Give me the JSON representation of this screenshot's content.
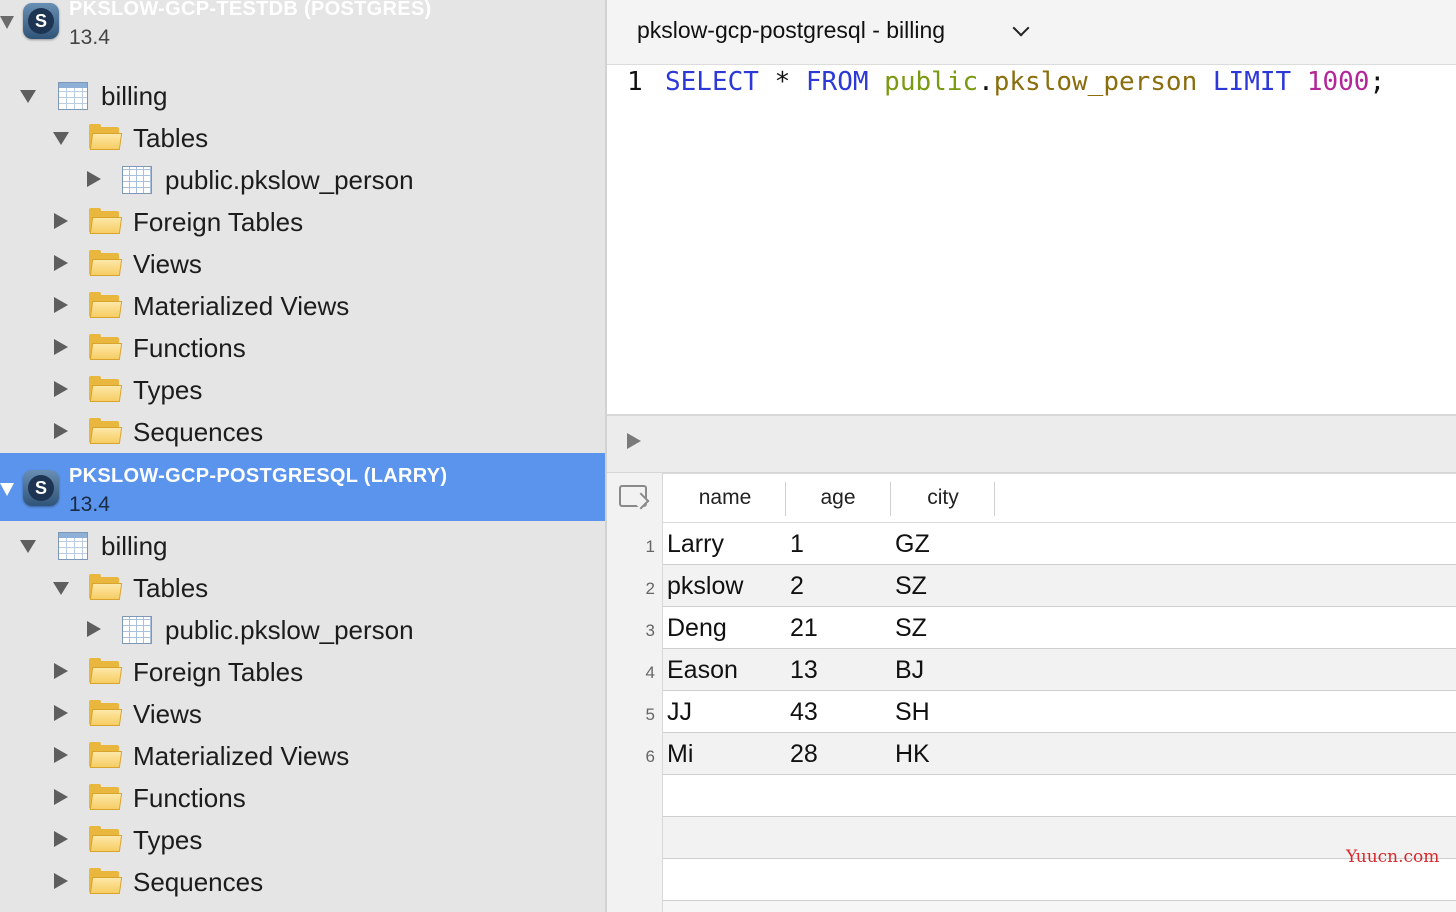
{
  "sidebar": {
    "connections": [
      {
        "name": "PKSLOW-GCP-TESTDB (POSTGRES)",
        "version": "13.4",
        "database": "billing",
        "tables_label": "Tables",
        "table_item": "public.pkslow_person",
        "groups": [
          "Foreign Tables",
          "Views",
          "Materialized Views",
          "Functions",
          "Types",
          "Sequences"
        ]
      },
      {
        "name": "PKSLOW-GCP-POSTGRESQL (LARRY)",
        "version": "13.4",
        "database": "billing",
        "tables_label": "Tables",
        "table_item": "public.pkslow_person",
        "groups": [
          "Foreign Tables",
          "Views",
          "Materialized Views",
          "Functions",
          "Types",
          "Sequences"
        ]
      }
    ],
    "selected_color": "#5a94ec"
  },
  "editor": {
    "tab_title": "pkslow-gcp-postgresql - billing",
    "line_number": "1",
    "tokens": {
      "select": "SELECT",
      "star": "*",
      "from": "FROM",
      "schema": "public",
      "dot": ".",
      "table": "pkslow_person",
      "limit": "LIMIT",
      "count": "1000",
      "semi": ";"
    }
  },
  "results": {
    "columns": [
      "name",
      "age",
      "city"
    ],
    "row_numbers": [
      "1",
      "2",
      "3",
      "4",
      "5",
      "6"
    ],
    "rows": [
      [
        "Larry",
        "1",
        "GZ"
      ],
      [
        "pkslow",
        "2",
        "SZ"
      ],
      [
        "Deng",
        "21",
        "SZ"
      ],
      [
        "Eason",
        "13",
        "BJ"
      ],
      [
        "JJ",
        "43",
        "SH"
      ],
      [
        "Mi",
        "28",
        "HK"
      ]
    ]
  },
  "watermark": "Yuucn.com"
}
